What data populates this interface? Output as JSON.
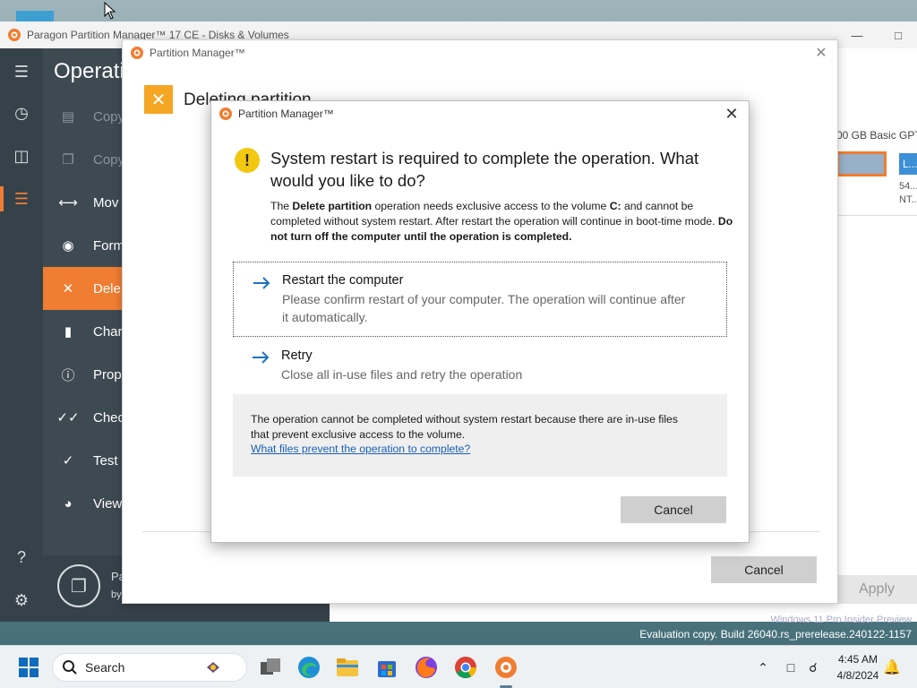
{
  "app": {
    "title": "Paragon Partition Manager™ 17 CE - Disks & Volumes",
    "minimize_icon": "minimize-icon",
    "maximize_icon": "maximize-icon"
  },
  "sidebar": {
    "heading": "Operati",
    "items": [
      {
        "label": "Copy",
        "icon": "os-copy-icon",
        "state": "disabled"
      },
      {
        "label": "Copy",
        "icon": "copy-icon",
        "state": "disabled"
      },
      {
        "label": "Mov",
        "icon": "move-arrows-icon",
        "state": "normal"
      },
      {
        "label": "Form",
        "icon": "format-icon",
        "state": "normal"
      },
      {
        "label": "Dele",
        "icon": "delete-x-icon",
        "state": "active"
      },
      {
        "label": "Char",
        "icon": "label-icon",
        "state": "normal"
      },
      {
        "label": "Prop",
        "icon": "info-icon",
        "state": "normal"
      },
      {
        "label": "Chec",
        "icon": "check-double-icon",
        "state": "normal"
      },
      {
        "label": "Test s",
        "icon": "check-icon",
        "state": "normal"
      },
      {
        "label": "View",
        "icon": "view-icon",
        "state": "normal"
      }
    ],
    "footer": {
      "line1": "Pa",
      "line2": "by"
    }
  },
  "disk_panel": {
    "disk_label": "00 GB Basic GPT",
    "partition_short": "L...",
    "partition_size": "54...",
    "partition_fs": "NT...",
    "apply_label": "Apply"
  },
  "wizard": {
    "title": "Partition Manager™",
    "heading": "Deleting partition",
    "cancel_label": "Cancel"
  },
  "restart_dialog": {
    "title": "Partition Manager™",
    "heading": "System restart is required to complete the operation. What would you like to do?",
    "body": {
      "p1": "The ",
      "b1": "Delete partition",
      "p2": " operation needs exclusive access to the volume ",
      "b2": "C:",
      "p3": " and cannot be completed without system restart. After restart the operation will continue in boot-time mode. ",
      "b3": "Do not turn off the computer until the operation is completed."
    },
    "options": [
      {
        "title": "Restart the computer",
        "desc": "Please confirm restart of your computer. The operation will continue after it automatically."
      },
      {
        "title": "Retry",
        "desc": "Close all in-use files and retry the operation"
      }
    ],
    "info_text": "The operation cannot be completed without system restart because there are in-use files that prevent exclusive access to the volume.",
    "info_link": "What files prevent the operation to complete?",
    "cancel_label": "Cancel"
  },
  "watermark": {
    "line1": "Windows 11 Pro Insider Preview",
    "line2": "Evaluation copy. Build 26040.rs_prerelease.240122-1157"
  },
  "taskbar": {
    "search_placeholder": "Search",
    "time": "4:45 AM",
    "date": "4/8/2024",
    "apps": [
      "task-view",
      "edge",
      "file-explorer",
      "microsoft-store",
      "firefox",
      "chrome",
      "paragon-partition-manager"
    ]
  },
  "colors": {
    "accent_orange": "#f07d32",
    "sidebar_bg": "#3e4a52",
    "warning_yellow": "#f2c811",
    "link_blue": "#1a5fb4",
    "arrow_blue": "#1e73be"
  }
}
